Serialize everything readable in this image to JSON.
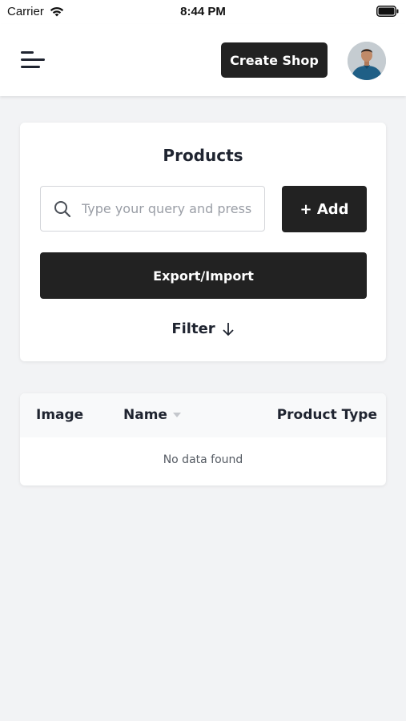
{
  "status_bar": {
    "carrier": "Carrier",
    "time": "8:44 PM"
  },
  "header": {
    "create_shop_label": "Create Shop"
  },
  "products": {
    "title": "Products",
    "search_placeholder": "Type your query and press",
    "add_label": "+ Add",
    "export_import_label": "Export/Import",
    "filter_label": "Filter"
  },
  "table": {
    "columns": [
      "Image",
      "Name",
      "Product Type"
    ],
    "empty_text": "No data found"
  },
  "colors": {
    "accent": "#222222",
    "background": "#f2f3f5"
  },
  "icons": [
    "wifi-icon",
    "battery-icon",
    "menu-icon",
    "avatar",
    "search-icon",
    "arrow-down-icon",
    "sort-icon"
  ]
}
